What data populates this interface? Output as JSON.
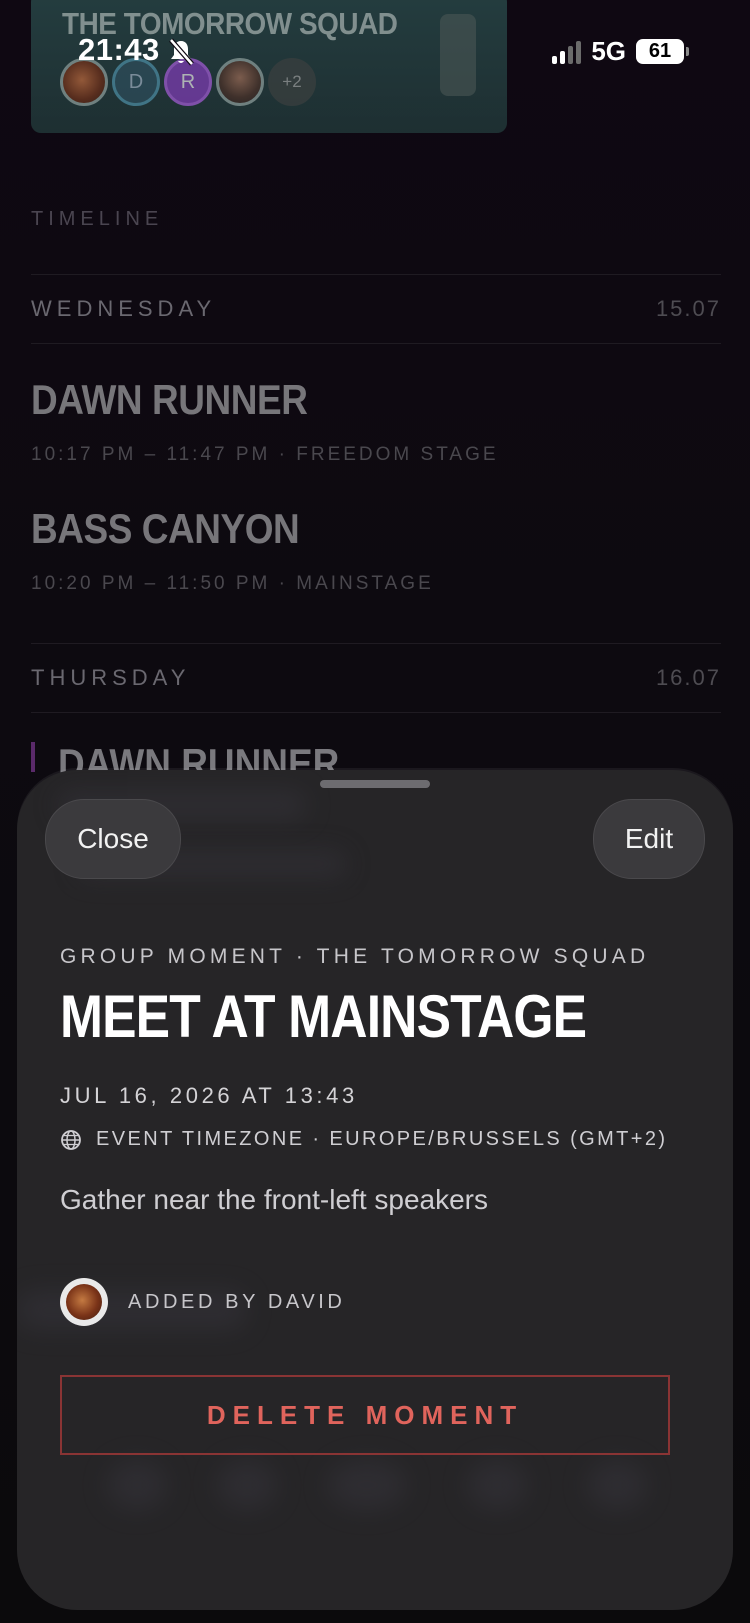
{
  "status_bar": {
    "time": "21:43",
    "network": "5G",
    "battery": "61"
  },
  "group_card": {
    "title": "THE TOMORROW SQUAD",
    "avatars": [
      {
        "kind": "photo",
        "initial": ""
      },
      {
        "kind": "initial",
        "initial": "D"
      },
      {
        "kind": "initial",
        "initial": "R"
      },
      {
        "kind": "photo",
        "initial": ""
      }
    ],
    "more_count": "+2"
  },
  "timeline": {
    "label": "TIMELINE",
    "days": [
      {
        "name": "WEDNESDAY",
        "date": "15.07",
        "acts": [
          {
            "title": "DAWN RUNNER",
            "meta": "10:17 PM – 11:47 PM · FREEDOM STAGE"
          },
          {
            "title": "BASS CANYON",
            "meta": "10:20 PM – 11:50 PM · MAINSTAGE"
          }
        ]
      },
      {
        "name": "THURSDAY",
        "date": "16.07",
        "acts": [
          {
            "title": "DAWN RUNNER",
            "meta": ""
          }
        ]
      }
    ]
  },
  "sheet": {
    "close_label": "Close",
    "edit_label": "Edit",
    "eyebrow": "GROUP MOMENT · THE TOMORROW SQUAD",
    "title": "MEET AT MAINSTAGE",
    "date": "JUL 16, 2026 AT 13:43",
    "timezone": "EVENT TIMEZONE · EUROPE/BRUSSELS (GMT+2)",
    "note": "Gather near the front-left speakers",
    "added_by": "ADDED BY DAVID",
    "delete_label": "DELETE MOMENT"
  },
  "colors": {
    "background": "#0d0a10",
    "sheet": "#262527",
    "danger": "#e0645c",
    "danger_border": "#8a3434",
    "group_card": "#356864"
  }
}
